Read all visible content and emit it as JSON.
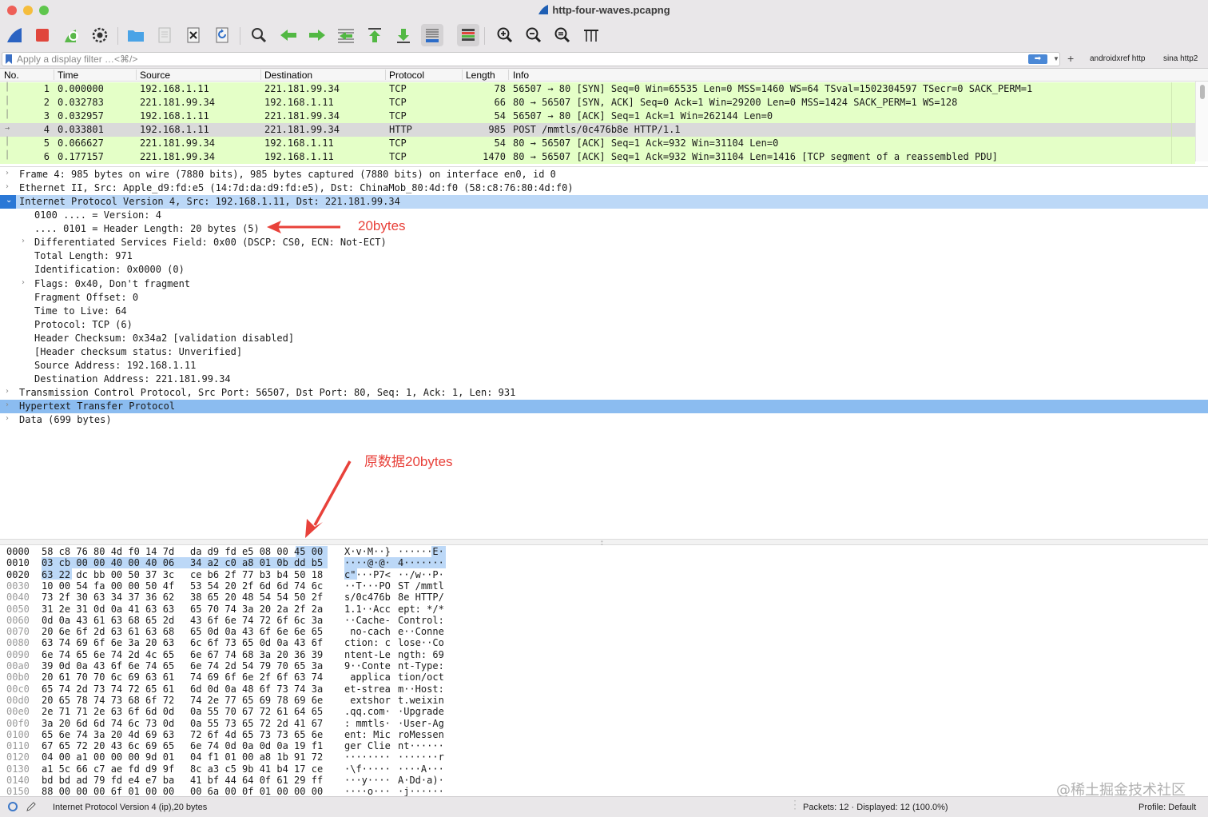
{
  "window": {
    "title": "http-four-waves.pcapng",
    "traffic_lights": [
      "#ee5f57",
      "#f5bd3c",
      "#5fc64d"
    ]
  },
  "toolbar": {
    "icons": [
      "shark-fin-start-icon",
      "stop-capture-icon",
      "restart-capture-icon",
      "capture-options-icon",
      "open-file-icon",
      "save-file-icon",
      "close-file-icon",
      "reload-file-icon",
      "find-packet-icon",
      "go-back-icon",
      "go-forward-icon",
      "go-to-packet-icon",
      "first-packet-icon",
      "last-packet-icon",
      "autoscroll-icon",
      "colorize-icon",
      "zoom-in-icon",
      "zoom-out-icon",
      "normal-size-icon",
      "resize-columns-icon"
    ]
  },
  "filter": {
    "placeholder": "Apply a display filter …<⌘/>",
    "add_label": "+",
    "buttons": [
      "androidxref http",
      "sina http2"
    ]
  },
  "packet_list": {
    "columns": [
      "No.",
      "Time",
      "Source",
      "Destination",
      "Protocol",
      "Length",
      "Info"
    ],
    "rows": [
      {
        "no": "1",
        "time": "0.000000",
        "src": "192.168.1.11",
        "dst": "221.181.99.34",
        "proto": "TCP",
        "len": "78",
        "info": "56507 → 80 [SYN] Seq=0 Win=65535 Len=0 MSS=1460 WS=64 TSval=1502304597 TSecr=0 SACK_PERM=1"
      },
      {
        "no": "2",
        "time": "0.032783",
        "src": "221.181.99.34",
        "dst": "192.168.1.11",
        "proto": "TCP",
        "len": "66",
        "info": "80 → 56507 [SYN, ACK] Seq=0 Ack=1 Win=29200 Len=0 MSS=1424 SACK_PERM=1 WS=128"
      },
      {
        "no": "3",
        "time": "0.032957",
        "src": "192.168.1.11",
        "dst": "221.181.99.34",
        "proto": "TCP",
        "len": "54",
        "info": "56507 → 80 [ACK] Seq=1 Ack=1 Win=262144 Len=0"
      },
      {
        "no": "4",
        "time": "0.033801",
        "src": "192.168.1.11",
        "dst": "221.181.99.34",
        "proto": "HTTP",
        "len": "985",
        "info": "POST /mmtls/0c476b8e HTTP/1.1"
      },
      {
        "no": "5",
        "time": "0.066627",
        "src": "221.181.99.34",
        "dst": "192.168.1.11",
        "proto": "TCP",
        "len": "54",
        "info": "80 → 56507 [ACK] Seq=1 Ack=932 Win=31104 Len=0"
      },
      {
        "no": "6",
        "time": "0.177157",
        "src": "221.181.99.34",
        "dst": "192.168.1.11",
        "proto": "TCP",
        "len": "1470",
        "info": "80 → 56507 [ACK] Seq=1 Ack=932 Win=31104 Len=1416 [TCP segment of a reassembled PDU]"
      }
    ],
    "selected_row_index": 3,
    "row_color": "#e4ffc7",
    "selected_color": "#dadada"
  },
  "details": {
    "rows": [
      {
        "text": "Frame 4: 985 bytes on wire (7880 bits), 985 bytes captured (7880 bits) on interface en0, id 0",
        "chevron": "›",
        "style": "tree"
      },
      {
        "text": "Ethernet II, Src: Apple_d9:fd:e5 (14:7d:da:d9:fd:e5), Dst: ChinaMob_80:4d:f0 (58:c8:76:80:4d:f0)",
        "chevron": "›",
        "style": "tree"
      },
      {
        "text": "Internet Protocol Version 4, Src: 192.168.1.11, Dst: 221.181.99.34",
        "chevron": "⌄",
        "style": "expanded"
      },
      {
        "text": "0100 .... = Version: 4",
        "chevron": "",
        "style": "leaf"
      },
      {
        "text": ".... 0101 = Header Length: 20 bytes (5)",
        "chevron": "",
        "style": "leaf"
      },
      {
        "text": "Differentiated Services Field: 0x00 (DSCP: CS0, ECN: Not-ECT)",
        "chevron": "›",
        "style": "subtree"
      },
      {
        "text": "Total Length: 971",
        "chevron": "",
        "style": "leaf"
      },
      {
        "text": "Identification: 0x0000 (0)",
        "chevron": "",
        "style": "leaf"
      },
      {
        "text": "Flags: 0x40, Don't fragment",
        "chevron": "›",
        "style": "subtree"
      },
      {
        "text": "Fragment Offset: 0",
        "chevron": "",
        "style": "leaf"
      },
      {
        "text": "Time to Live: 64",
        "chevron": "",
        "style": "leaf"
      },
      {
        "text": "Protocol: TCP (6)",
        "chevron": "",
        "style": "leaf"
      },
      {
        "text": "Header Checksum: 0x34a2 [validation disabled]",
        "chevron": "",
        "style": "leaf"
      },
      {
        "text": "[Header checksum status: Unverified]",
        "chevron": "",
        "style": "leaf"
      },
      {
        "text": "Source Address: 192.168.1.11",
        "chevron": "",
        "style": "leaf"
      },
      {
        "text": "Destination Address: 221.181.99.34",
        "chevron": "",
        "style": "leaf"
      },
      {
        "text": "Transmission Control Protocol, Src Port: 56507, Dst Port: 80, Seq: 1, Ack: 1, Len: 931",
        "chevron": "›",
        "style": "tree"
      },
      {
        "text": "Hypertext Transfer Protocol",
        "chevron": "›",
        "style": "selected"
      },
      {
        "text": "Data (699 bytes)",
        "chevron": "›",
        "style": "tree"
      }
    ]
  },
  "annotations": {
    "header_bytes": "20bytes",
    "raw_bytes": "原数据20bytes",
    "color": "#e8413a"
  },
  "bytes": {
    "rows": [
      {
        "off": "0000",
        "h1": "58 c8 76 80 4d f0 14 7d",
        "h2": "da d9 fd e5 08 00 45 00",
        "a1": "X·v·M··}",
        "a2": "······E·"
      },
      {
        "off": "0010",
        "h1": "03 cb 00 00 40 00 40 06",
        "h2": "34 a2 c0 a8 01 0b dd b5",
        "a1": "····@·@·",
        "a2": "4·······"
      },
      {
        "off": "0020",
        "h1": "63 22 dc bb 00 50 37 3c",
        "h2": "ce b6 2f 77 b3 b4 50 18",
        "a1": "c\"···P7<",
        "a2": "··/w··P·"
      },
      {
        "off": "0030",
        "h1": "10 00 54 fa 00 00 50 4f",
        "h2": "53 54 20 2f 6d 6d 74 6c",
        "a1": "··T···PO",
        "a2": "ST /mmtl"
      },
      {
        "off": "0040",
        "h1": "73 2f 30 63 34 37 36 62",
        "h2": "38 65 20 48 54 54 50 2f",
        "a1": "s/0c476b",
        "a2": "8e HTTP/"
      },
      {
        "off": "0050",
        "h1": "31 2e 31 0d 0a 41 63 63",
        "h2": "65 70 74 3a 20 2a 2f 2a",
        "a1": "1.1··Acc",
        "a2": "ept: */*"
      },
      {
        "off": "0060",
        "h1": "0d 0a 43 61 63 68 65 2d",
        "h2": "43 6f 6e 74 72 6f 6c 3a",
        "a1": "··Cache-",
        "a2": "Control:"
      },
      {
        "off": "0070",
        "h1": "20 6e 6f 2d 63 61 63 68",
        "h2": "65 0d 0a 43 6f 6e 6e 65",
        "a1": " no-cach",
        "a2": "e··Conne"
      },
      {
        "off": "0080",
        "h1": "63 74 69 6f 6e 3a 20 63",
        "h2": "6c 6f 73 65 0d 0a 43 6f",
        "a1": "ction: c",
        "a2": "lose··Co"
      },
      {
        "off": "0090",
        "h1": "6e 74 65 6e 74 2d 4c 65",
        "h2": "6e 67 74 68 3a 20 36 39",
        "a1": "ntent-Le",
        "a2": "ngth: 69"
      },
      {
        "off": "00a0",
        "h1": "39 0d 0a 43 6f 6e 74 65",
        "h2": "6e 74 2d 54 79 70 65 3a",
        "a1": "9··Conte",
        "a2": "nt-Type:"
      },
      {
        "off": "00b0",
        "h1": "20 61 70 70 6c 69 63 61",
        "h2": "74 69 6f 6e 2f 6f 63 74",
        "a1": " applica",
        "a2": "tion/oct"
      },
      {
        "off": "00c0",
        "h1": "65 74 2d 73 74 72 65 61",
        "h2": "6d 0d 0a 48 6f 73 74 3a",
        "a1": "et-strea",
        "a2": "m··Host:"
      },
      {
        "off": "00d0",
        "h1": "20 65 78 74 73 68 6f 72",
        "h2": "74 2e 77 65 69 78 69 6e",
        "a1": " extshor",
        "a2": "t.weixin"
      },
      {
        "off": "00e0",
        "h1": "2e 71 71 2e 63 6f 6d 0d",
        "h2": "0a 55 70 67 72 61 64 65",
        "a1": ".qq.com·",
        "a2": "·Upgrade"
      },
      {
        "off": "00f0",
        "h1": "3a 20 6d 6d 74 6c 73 0d",
        "h2": "0a 55 73 65 72 2d 41 67",
        "a1": ": mmtls·",
        "a2": "·User-Ag"
      },
      {
        "off": "0100",
        "h1": "65 6e 74 3a 20 4d 69 63",
        "h2": "72 6f 4d 65 73 73 65 6e",
        "a1": "ent: Mic",
        "a2": "roMessen"
      },
      {
        "off": "0110",
        "h1": "67 65 72 20 43 6c 69 65",
        "h2": "6e 74 0d 0a 0d 0a 19 f1",
        "a1": "ger Clie",
        "a2": "nt······"
      },
      {
        "off": "0120",
        "h1": "04 00 a1 00 00 00 9d 01",
        "h2": "04 f1 01 00 a8 1b 91 72",
        "a1": "········",
        "a2": "·······r"
      },
      {
        "off": "0130",
        "h1": "a1 5c 66 c7 ae fd d9 9f",
        "h2": "8c a3 c5 9b 41 b4 17 ce",
        "a1": "·\\f·····",
        "a2": "····A···"
      },
      {
        "off": "0140",
        "h1": "bd bd ad 79 fd e4 e7 ba",
        "h2": "41 bf 44 64 0f 61 29 ff",
        "a1": "···y····",
        "a2": "A·Dd·a)·"
      },
      {
        "off": "0150",
        "h1": "88 00 00 00 6f 01 00 00",
        "h2": "00 6a 00 0f 01 00 00 00",
        "a1": "····o···",
        "a2": "·j······"
      }
    ]
  },
  "status": {
    "field_info": "Internet Protocol Version 4 (ip),20 bytes",
    "packets": "Packets: 12 · Displayed: 12 (100.0%)",
    "profile": "Profile: Default"
  },
  "watermark": "@稀土掘金技术社区"
}
